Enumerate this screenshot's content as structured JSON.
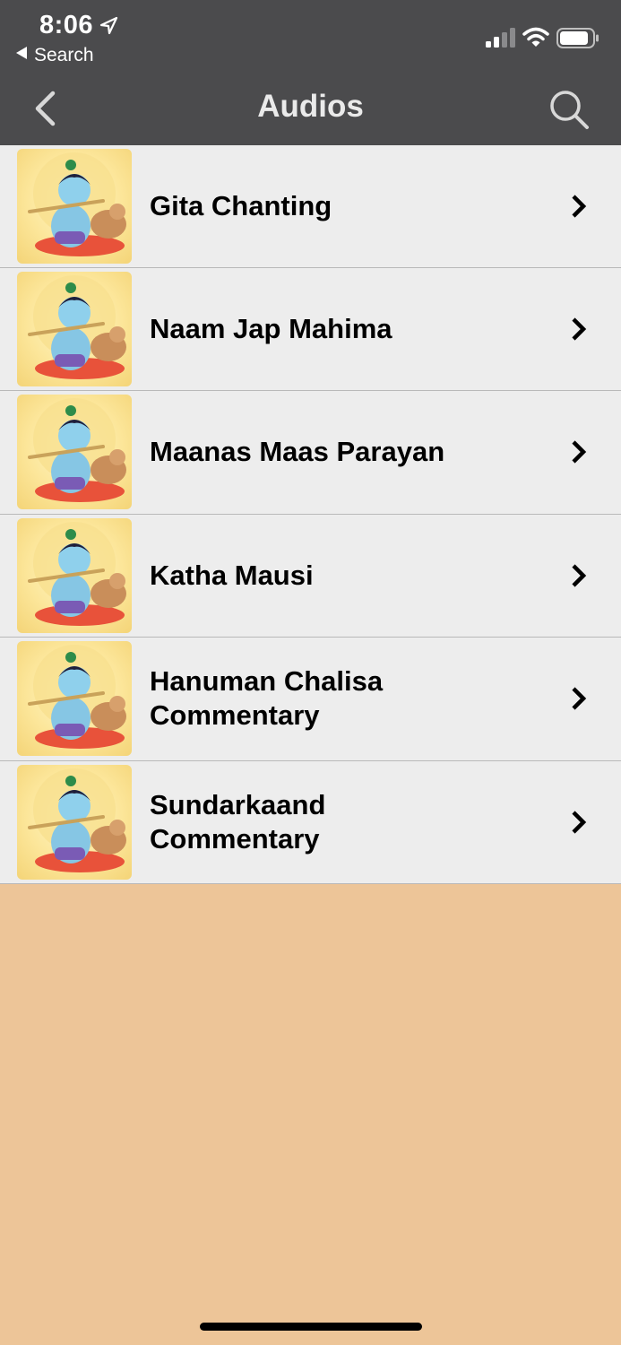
{
  "status_bar": {
    "time": "8:06",
    "back_to_app": "Search",
    "icons": [
      "location-arrow-icon",
      "signal-icon",
      "wifi-icon",
      "battery-icon"
    ]
  },
  "nav": {
    "title": "Audios",
    "back_icon": "chevron-left-icon",
    "search_icon": "search-icon"
  },
  "items": [
    {
      "title": "Gita Chanting"
    },
    {
      "title": "Naam Jap Mahima"
    },
    {
      "title": "Maanas Maas Parayan"
    },
    {
      "title": "Katha Mausi"
    },
    {
      "title": "Hanuman Chalisa\nCommentary"
    },
    {
      "title": "Sundarkaand\nCommentary"
    }
  ],
  "colors": {
    "nav_bar": "#4B4B4D",
    "row_bg": "#EDEDED",
    "page_bg": "#EDC598"
  }
}
